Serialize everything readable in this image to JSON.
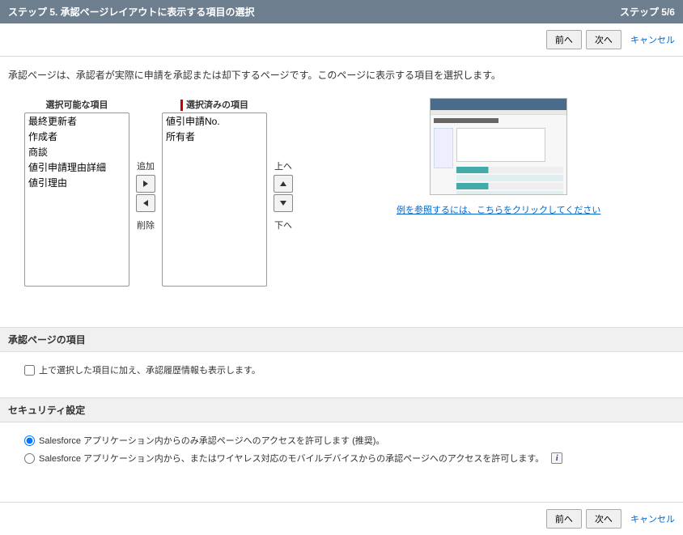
{
  "header": {
    "title": "ステップ 5. 承認ページレイアウトに表示する項目の選択",
    "step": "ステップ 5/6"
  },
  "buttons": {
    "prev": "前へ",
    "next": "次へ",
    "cancel": "キャンセル"
  },
  "intro": "承認ページは、承認者が実際に申請を承認または却下するページです。このページに表示する項目を選択します。",
  "picker": {
    "available_label": "選択可能な項目",
    "selected_label": "選択済みの項目",
    "available": [
      "最終更新者",
      "作成者",
      "商談",
      "値引申請理由詳細",
      "値引理由"
    ],
    "selected": [
      "値引申請No.",
      "所有者"
    ],
    "add": "追加",
    "remove": "削除",
    "up": "上へ",
    "down": "下へ"
  },
  "example": {
    "link": "例を参照するには、こちらをクリックしてください"
  },
  "approvalFields": {
    "header": "承認ページの項目",
    "checkbox_label": "上で選択した項目に加え、承認履歴情報も表示します。"
  },
  "security": {
    "header": "セキュリティ設定",
    "opt1": "Salesforce アプリケーション内からのみ承認ページへのアクセスを許可します (推奨)。",
    "opt2": "Salesforce アプリケーション内から、またはワイヤレス対応のモバイルデバイスからの承認ページへのアクセスを許可します。"
  }
}
